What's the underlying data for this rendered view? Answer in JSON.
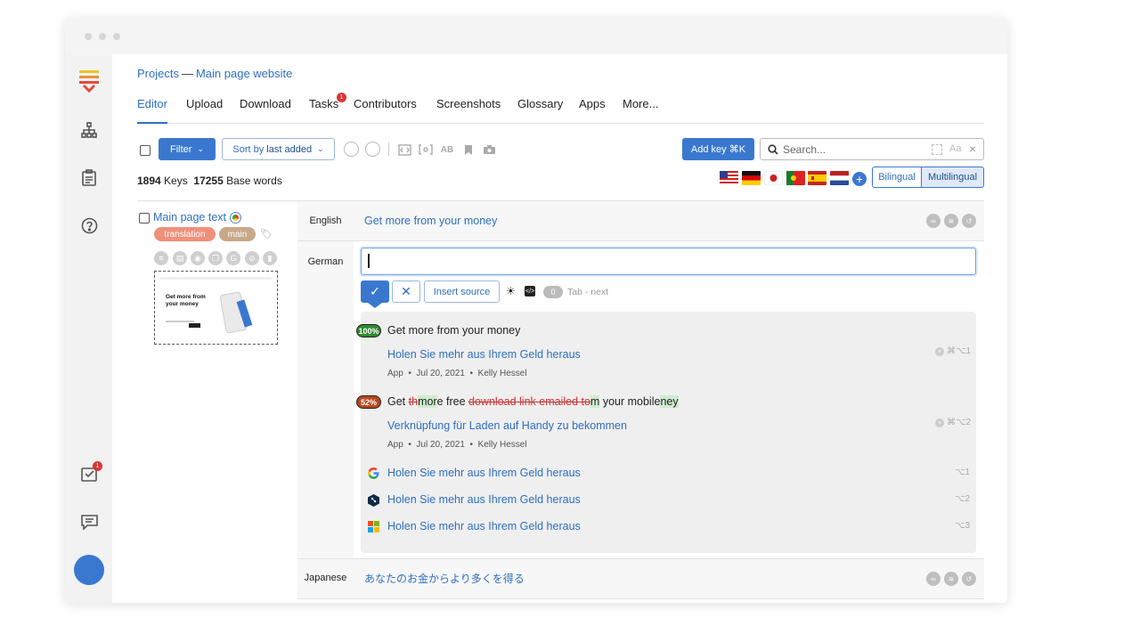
{
  "breadcrumb": {
    "projects": "Projects",
    "separator": "—",
    "project_name": "Main page website"
  },
  "tabs": [
    {
      "label": "Editor"
    },
    {
      "label": "Upload"
    },
    {
      "label": "Download"
    },
    {
      "label": "Tasks",
      "badge": "1"
    },
    {
      "label": "Contributors"
    },
    {
      "label": "Screenshots"
    },
    {
      "label": "Glossary"
    },
    {
      "label": "Apps"
    },
    {
      "label": "More..."
    }
  ],
  "sidebar": {
    "tasks_badge": "1"
  },
  "toolbar": {
    "filter_label": "Filter",
    "sort_prefix": "Sort by ",
    "sort_value": "last added",
    "add_key_label": "Add key ⌘K",
    "search_placeholder": "Search..."
  },
  "stats": {
    "keys_count": "1894",
    "keys_label": "Keys",
    "words_count": "17255",
    "words_label": "Base words"
  },
  "view_mode": {
    "bilingual": "Bilingual",
    "multilingual": "Multilingual",
    "selected": "Multilingual"
  },
  "key": {
    "name": "Main page text",
    "tags": [
      "translation",
      "main"
    ],
    "screenshot": {
      "headline": "Get more from your money"
    }
  },
  "rows": {
    "english": {
      "language": "English",
      "text": "Get more from your money"
    },
    "german": {
      "language": "German",
      "value": ""
    },
    "japanese": {
      "language": "Japanese",
      "text": "あなたのお金からより多くを得る"
    }
  },
  "editor_actions": {
    "insert_source": "Insert source",
    "char_count": "0",
    "hint": "Tab - next"
  },
  "tm_suggestions": [
    {
      "match": "100%",
      "source": "Get more from your money",
      "translation": "Holen Sie mehr aus Ihrem Geld heraus",
      "meta_app": "App",
      "meta_date": "Jul 20, 2021",
      "meta_author": "Kelly Hessel",
      "shortcut": "⌘⌥1"
    },
    {
      "match": "52%",
      "translation": "Verknüpfung für Laden auf Handy zu bekommen",
      "meta_app": "App",
      "meta_date": "Jul 20, 2021",
      "meta_author": "Kelly Hessel",
      "shortcut": "⌘⌥2"
    }
  ],
  "mt_suggestions": [
    {
      "engine": "google-icon",
      "translation": "Holen Sie mehr aus Ihrem Geld heraus",
      "shortcut": "⌥1"
    },
    {
      "engine": "deepl-icon",
      "translation": "Holen Sie mehr aus Ihrem Geld heraus",
      "shortcut": "⌥2"
    },
    {
      "engine": "microsoft-icon",
      "translation": "Holen Sie mehr aus Ihrem Geld heraus",
      "shortcut": "⌥3"
    }
  ],
  "colors": {
    "accent": "#3a78d0",
    "match100": "#2e8b2e",
    "match52": "#b8471b",
    "tag_translation": "#f0907a",
    "tag_main": "#c9a888"
  }
}
